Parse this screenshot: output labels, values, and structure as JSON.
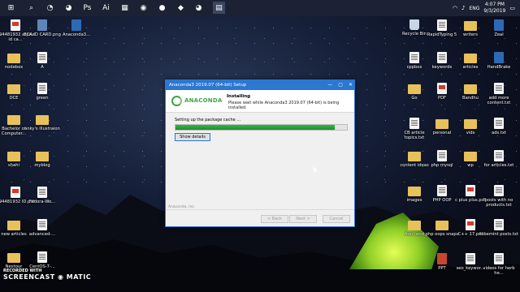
{
  "taskbar": {
    "icons": [
      "windows-logo-icon",
      "search-icon",
      "chat-icon",
      "chrome-icon",
      "photoshop-icon",
      "illustrator-icon",
      "calculator-icon",
      "camera-icon",
      "recorder-icon",
      "vscode-icon",
      "chrome-icon",
      "explorer-icon"
    ],
    "language": "ENG",
    "time": "4:07 PM",
    "date": "9/3/2019"
  },
  "desktop": {
    "left_icons": [
      {
        "label": "194481932 arpita id ca...",
        "kind": "pdf"
      },
      {
        "label": "BCA ID CARD.png",
        "kind": "img"
      },
      {
        "label": "Anaconda3...",
        "kind": "exe"
      },
      {
        "label": "nodebox",
        "kind": "folder"
      },
      {
        "label": "A",
        "kind": "txt"
      },
      {
        "label": "DCE",
        "kind": "folder"
      },
      {
        "label": "green",
        "kind": "txt"
      },
      {
        "label": "Bachelor of Computer...",
        "kind": "folder"
      },
      {
        "label": "anky's illustraion",
        "kind": "folder"
      },
      {
        "label": "shahi",
        "kind": "folder"
      },
      {
        "label": "myblog",
        "kind": "folder"
      },
      {
        "label": "194481932 ID.pdf",
        "kind": "pdf"
      },
      {
        "label": "Fedora-Wo...",
        "kind": "txt"
      },
      {
        "label": "new articles",
        "kind": "folder"
      },
      {
        "label": "advanced-...",
        "kind": "txt"
      },
      {
        "label": "Nextour",
        "kind": "folder"
      },
      {
        "label": "CentOS-7-...",
        "kind": "txt"
      }
    ],
    "right_icons": [
      {
        "label": "Recycle Bin",
        "kind": "recycle"
      },
      {
        "label": "RapidTyping 5",
        "kind": "txt"
      },
      {
        "label": "writers",
        "kind": "folder"
      },
      {
        "label": "Zeal",
        "kind": "exe"
      },
      {
        "label": "cppbox",
        "kind": "txt"
      },
      {
        "label": "keywords",
        "kind": "txt"
      },
      {
        "label": "articles",
        "kind": "folder"
      },
      {
        "label": "HandBrake",
        "kind": "exe"
      },
      {
        "label": "Go",
        "kind": "folder"
      },
      {
        "label": "PDF",
        "kind": "pdf"
      },
      {
        "label": "Bandhu",
        "kind": "folder"
      },
      {
        "label": "add more content.txt",
        "kind": "txt"
      },
      {
        "label": "CB article topics.txt",
        "kind": "txt"
      },
      {
        "label": "personal",
        "kind": "folder"
      },
      {
        "label": "vids",
        "kind": "folder"
      },
      {
        "label": "ads.txt",
        "kind": "txt"
      },
      {
        "label": "content ideas",
        "kind": "folder"
      },
      {
        "label": "php mysql",
        "kind": "txt"
      },
      {
        "label": "wp",
        "kind": "folder"
      },
      {
        "label": "for articles.txt",
        "kind": "txt"
      },
      {
        "label": "images",
        "kind": "folder"
      },
      {
        "label": "PHP OOP",
        "kind": "txt"
      },
      {
        "label": "c plus plus.pdf",
        "kind": "pdf"
      },
      {
        "label": "posts with no products.txt",
        "kind": "txt"
      },
      {
        "label": "front end",
        "kind": "folder"
      },
      {
        "label": "php oops snaps",
        "kind": "folder"
      },
      {
        "label": "C++ 17.pdf",
        "kind": "pdf"
      },
      {
        "label": "tubemint posts.txt",
        "kind": "txt"
      },
      {
        "label": "PPT",
        "kind": "ppt"
      },
      {
        "label": "seo_keywor...",
        "kind": "txt"
      },
      {
        "label": "videos for herb he...",
        "kind": "txt"
      }
    ]
  },
  "dialog": {
    "title": "Anaconda3 2019.07 (64-bit) Setup",
    "header_title": "Installing",
    "header_subtitle": "Please wait while Anaconda3 2019.07 (64-bit) is being installed.",
    "logo_text": "ANACONDA",
    "status_text": "Setting up the package cache ...",
    "progress": 0.93,
    "show_details_label": "Show details",
    "vendor": "Anaconda, Inc.",
    "back_label": "< Back",
    "next_label": "Next >",
    "cancel_label": "Cancel",
    "accent_color": "#2b77d1",
    "progress_color": "#37b34a"
  },
  "watermark": {
    "top": "RECORDED WITH",
    "bottom": "SCREENCAST ◉ MATIC"
  }
}
